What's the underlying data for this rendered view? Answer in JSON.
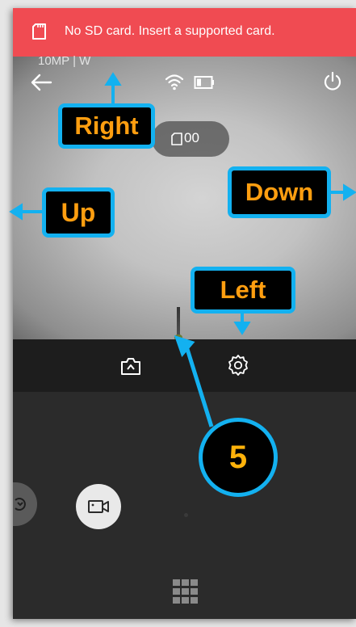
{
  "banner": {
    "message": "No SD card. Insert a supported card.",
    "background": "#f04b52"
  },
  "viewfinder": {
    "resolution_label": "10MP | W",
    "shot_counter": "00"
  },
  "icons": {
    "sd_card": "sd-card-icon",
    "back": "back-arrow-icon",
    "wifi": "wifi-icon",
    "battery": "battery-icon",
    "power": "power-icon",
    "camera_mode": "camera-mode-icon",
    "settings": "gear-icon",
    "switch_camera": "switch-camera-icon",
    "video": "video-camera-icon",
    "grid_menu": "grid-menu-icon"
  },
  "annotations": {
    "right": "Right",
    "up": "Up",
    "down": "Down",
    "left": "Left",
    "step_number": "5",
    "label_color": "#ff9e10",
    "border_color": "#13b1f0"
  }
}
